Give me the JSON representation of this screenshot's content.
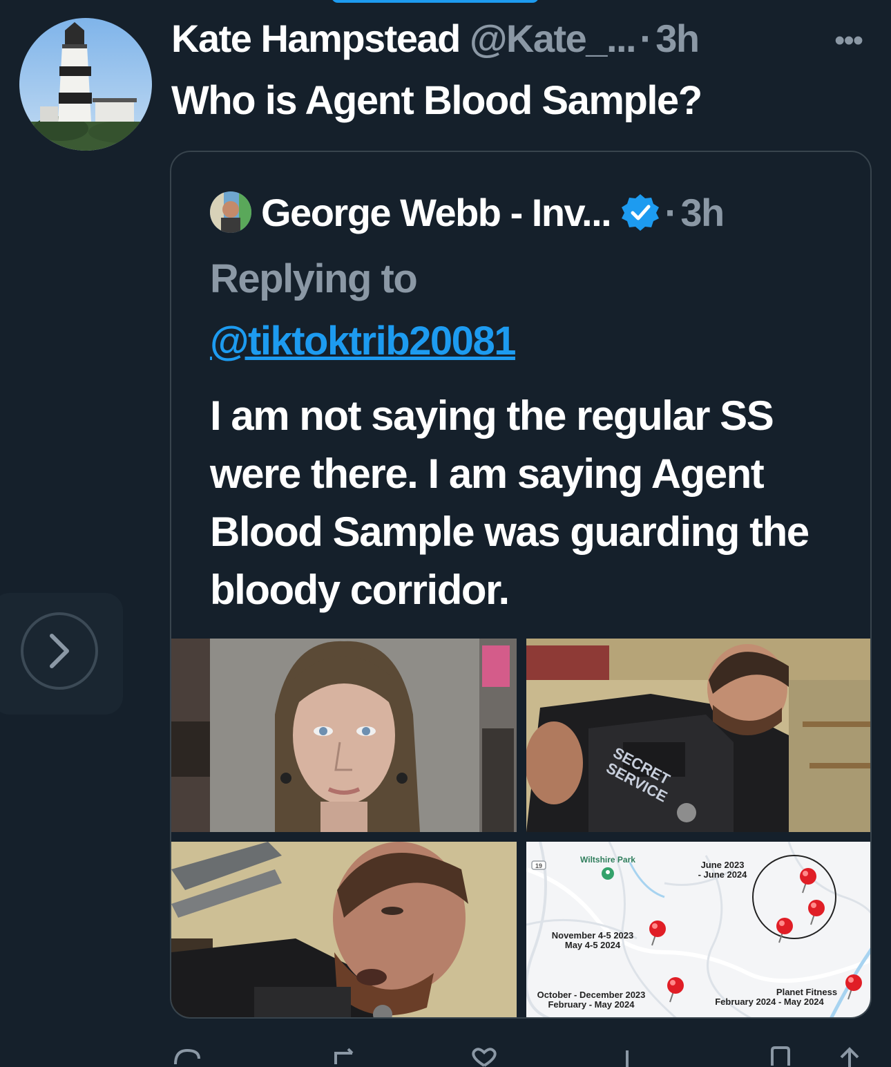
{
  "author": {
    "name": "Kate Hampstead",
    "handle": "@Kate_...",
    "separator": "·",
    "time": "3h"
  },
  "more_icon": "more-horizontal-icon",
  "tweet_text": "Who is Agent Blood Sample?",
  "quote": {
    "name": "George Webb - Inv...",
    "separator": "·",
    "time": "3h",
    "verified_color": "#1d9bf0",
    "replying_label": "Replying to",
    "mention": "@tiktoktrib20081",
    "body": "I am not saying the regular SS were there. I am saying Agent Blood Sample was guarding the bloody corridor.",
    "images": [
      {
        "alt": "mugshot"
      },
      {
        "alt": "agent photo",
        "vest_text_1": "SECRET",
        "vest_text_2": "SERVICE"
      },
      {
        "alt": "agent close-up"
      },
      {
        "alt": "map",
        "labels": {
          "park": "Wiltshire Park",
          "road": "19",
          "june_1": "June 2023",
          "june_2": "- June 2024",
          "nov_1": "November 4-5 2023",
          "nov_2": "May 4-5 2024",
          "oct_1": "October - December 2023",
          "oct_2": "February - May 2024",
          "pf_1": "Planet Fitness",
          "pf_2": "February 2024 - May 2024"
        }
      }
    ]
  },
  "side_nav_icon": "chevron-right-icon",
  "colors": {
    "background": "#15202b",
    "border": "#38444d",
    "secondary_text": "#8b98a5",
    "link": "#1d9bf0"
  }
}
